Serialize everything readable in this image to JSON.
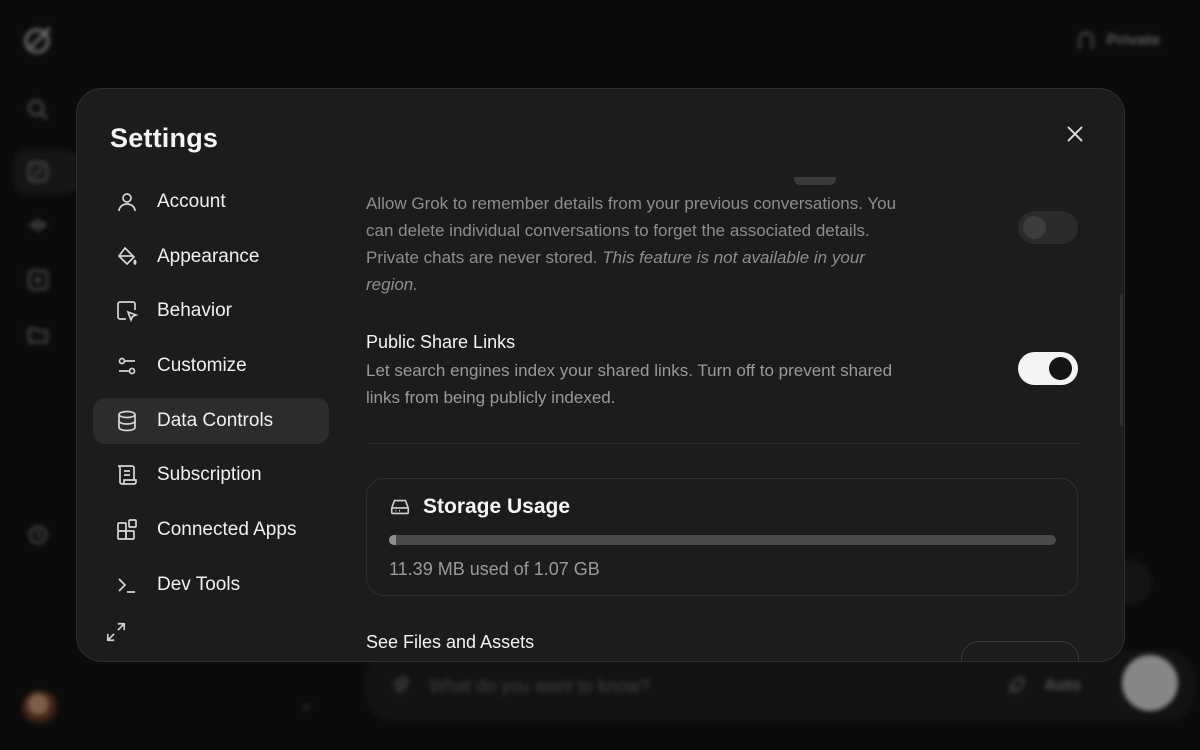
{
  "background": {
    "private_label": "Private",
    "chat_placeholder": "What do you want to know?",
    "model_label": "Auto"
  },
  "modal": {
    "title": "Settings",
    "nav": [
      {
        "label": "Account",
        "icon": "user-icon"
      },
      {
        "label": "Appearance",
        "icon": "paint-bucket-icon"
      },
      {
        "label": "Behavior",
        "icon": "cursor-square-icon"
      },
      {
        "label": "Customize",
        "icon": "sliders-icon"
      },
      {
        "label": "Data Controls",
        "icon": "database-icon",
        "active": true
      },
      {
        "label": "Subscription",
        "icon": "receipt-icon"
      },
      {
        "label": "Connected Apps",
        "icon": "apps-grid-icon"
      },
      {
        "label": "Dev Tools",
        "icon": "terminal-icon"
      }
    ],
    "memory": {
      "description": "Allow Grok to remember details from your previous conversations. You can delete individual conversations to forget the associated details. Private chats are never stored.",
      "notice": "This feature is not available in your region.",
      "enabled": false
    },
    "public_share_links": {
      "title": "Public Share Links",
      "description": "Let search engines index your shared links. Turn off to prevent shared links from being publicly indexed.",
      "enabled": true
    },
    "storage": {
      "title": "Storage Usage",
      "usage_text": "11.39 MB used of 1.07 GB",
      "used_fraction": 0.0104
    },
    "files": {
      "title": "See Files and Assets"
    }
  },
  "colors": {
    "background": "#0b0b0b",
    "modal": "#1c1c1c",
    "active_nav": "#2c2c2c",
    "toggle_on": "#f4f4f4"
  }
}
